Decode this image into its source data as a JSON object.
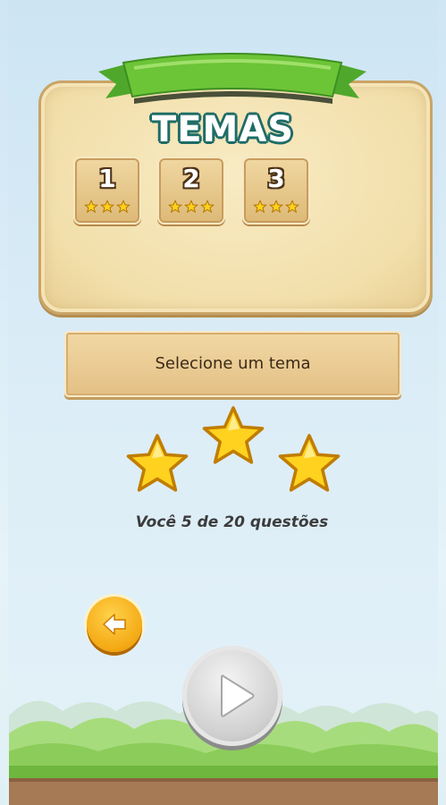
{
  "screen": {
    "title": "TEMAS",
    "levels": [
      {
        "label": "1",
        "stars": 3
      },
      {
        "label": "2",
        "stars": 3
      },
      {
        "label": "3",
        "stars": 3
      }
    ],
    "select_label": "Selecione um tema",
    "rating_stars": 3,
    "progress_text": "Você 5 de 20 questões"
  },
  "icons": {
    "back": "arrow-left-icon",
    "play": "play-icon",
    "star": "star-icon"
  },
  "colors": {
    "ribbon_green": "#6cc437",
    "title_outline": "#1f6c66",
    "panel": "#f2dfab",
    "star_yellow": "#ffd21f",
    "back_button": "#f4a914",
    "play_button": "#cfcfcf"
  }
}
